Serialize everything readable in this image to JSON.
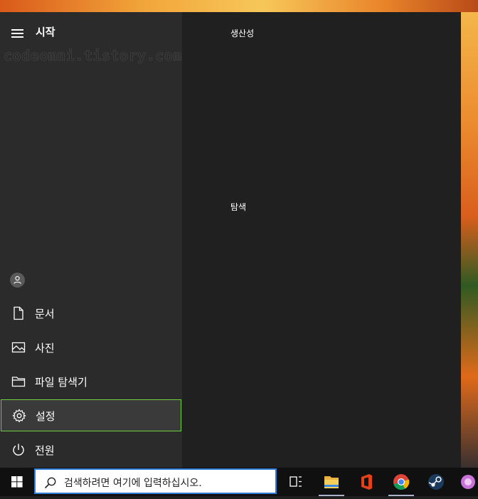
{
  "start_menu": {
    "title": "시작",
    "watermark": "codeomni.tistory.com",
    "groups": [
      {
        "label": "생산성"
      },
      {
        "label": "탐색"
      }
    ],
    "rail_items": [
      {
        "label": "문서",
        "icon": "document-icon"
      },
      {
        "label": "사진",
        "icon": "pictures-icon"
      },
      {
        "label": "파일 탐색기",
        "icon": "folder-icon"
      },
      {
        "label": "설정",
        "icon": "gear-icon"
      },
      {
        "label": "전원",
        "icon": "power-icon"
      }
    ]
  },
  "taskbar": {
    "search_placeholder": "검색하려면 여기에 입력하십시오.",
    "pinned": [
      "task-view-icon",
      "file-explorer-icon",
      "office-icon",
      "chrome-icon",
      "steam-icon",
      "app-icon"
    ]
  },
  "colors": {
    "selection_border": "#6fcf3f",
    "search_border": "#2f7dd8"
  }
}
